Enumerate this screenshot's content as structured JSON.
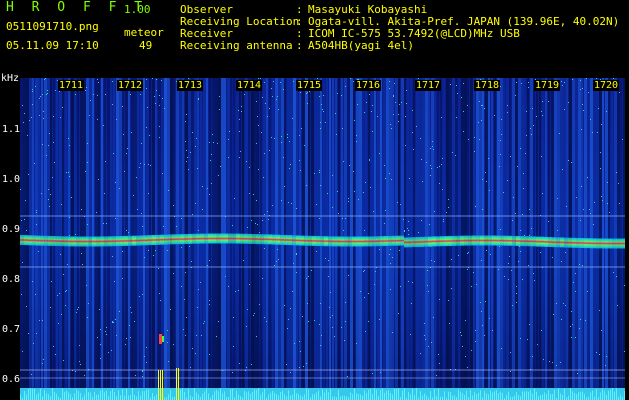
{
  "header": {
    "app_title": "H R O F F T",
    "version": "1.00",
    "filename": "0511091710.png",
    "meteor_label": "meteor",
    "datetime": "05.11.09 17:10",
    "meteor_count": "49"
  },
  "meta": [
    {
      "label": "Observer",
      "sep": ":",
      "value": "Masayuki Kobayashi"
    },
    {
      "label": "Receiving Location",
      "sep": ":",
      "value": "Ogata-vill. Akita-Pref. JAPAN (139.96E, 40.02N)"
    },
    {
      "label": "Receiver",
      "sep": ":",
      "value": "ICOM IC-575 53.7492(@LCD)MHz USB"
    },
    {
      "label": "Receiving antenna",
      "sep": ":",
      "value": "A504HB(yagi 4el)"
    }
  ],
  "axis": {
    "y_unit": "kHz",
    "y_ticks": [
      "1.1",
      "1.0",
      "0.9",
      "0.8",
      "0.7",
      "0.6"
    ],
    "time_marks": [
      "1711",
      "1712",
      "1713",
      "1714",
      "1715",
      "1716",
      "1717",
      "1718",
      "1719",
      "1720"
    ]
  },
  "colors": {
    "text_yellow": "#ffff00",
    "text_green": "#7fff00",
    "background": "#000000",
    "signal_band": "#ff2060"
  }
}
